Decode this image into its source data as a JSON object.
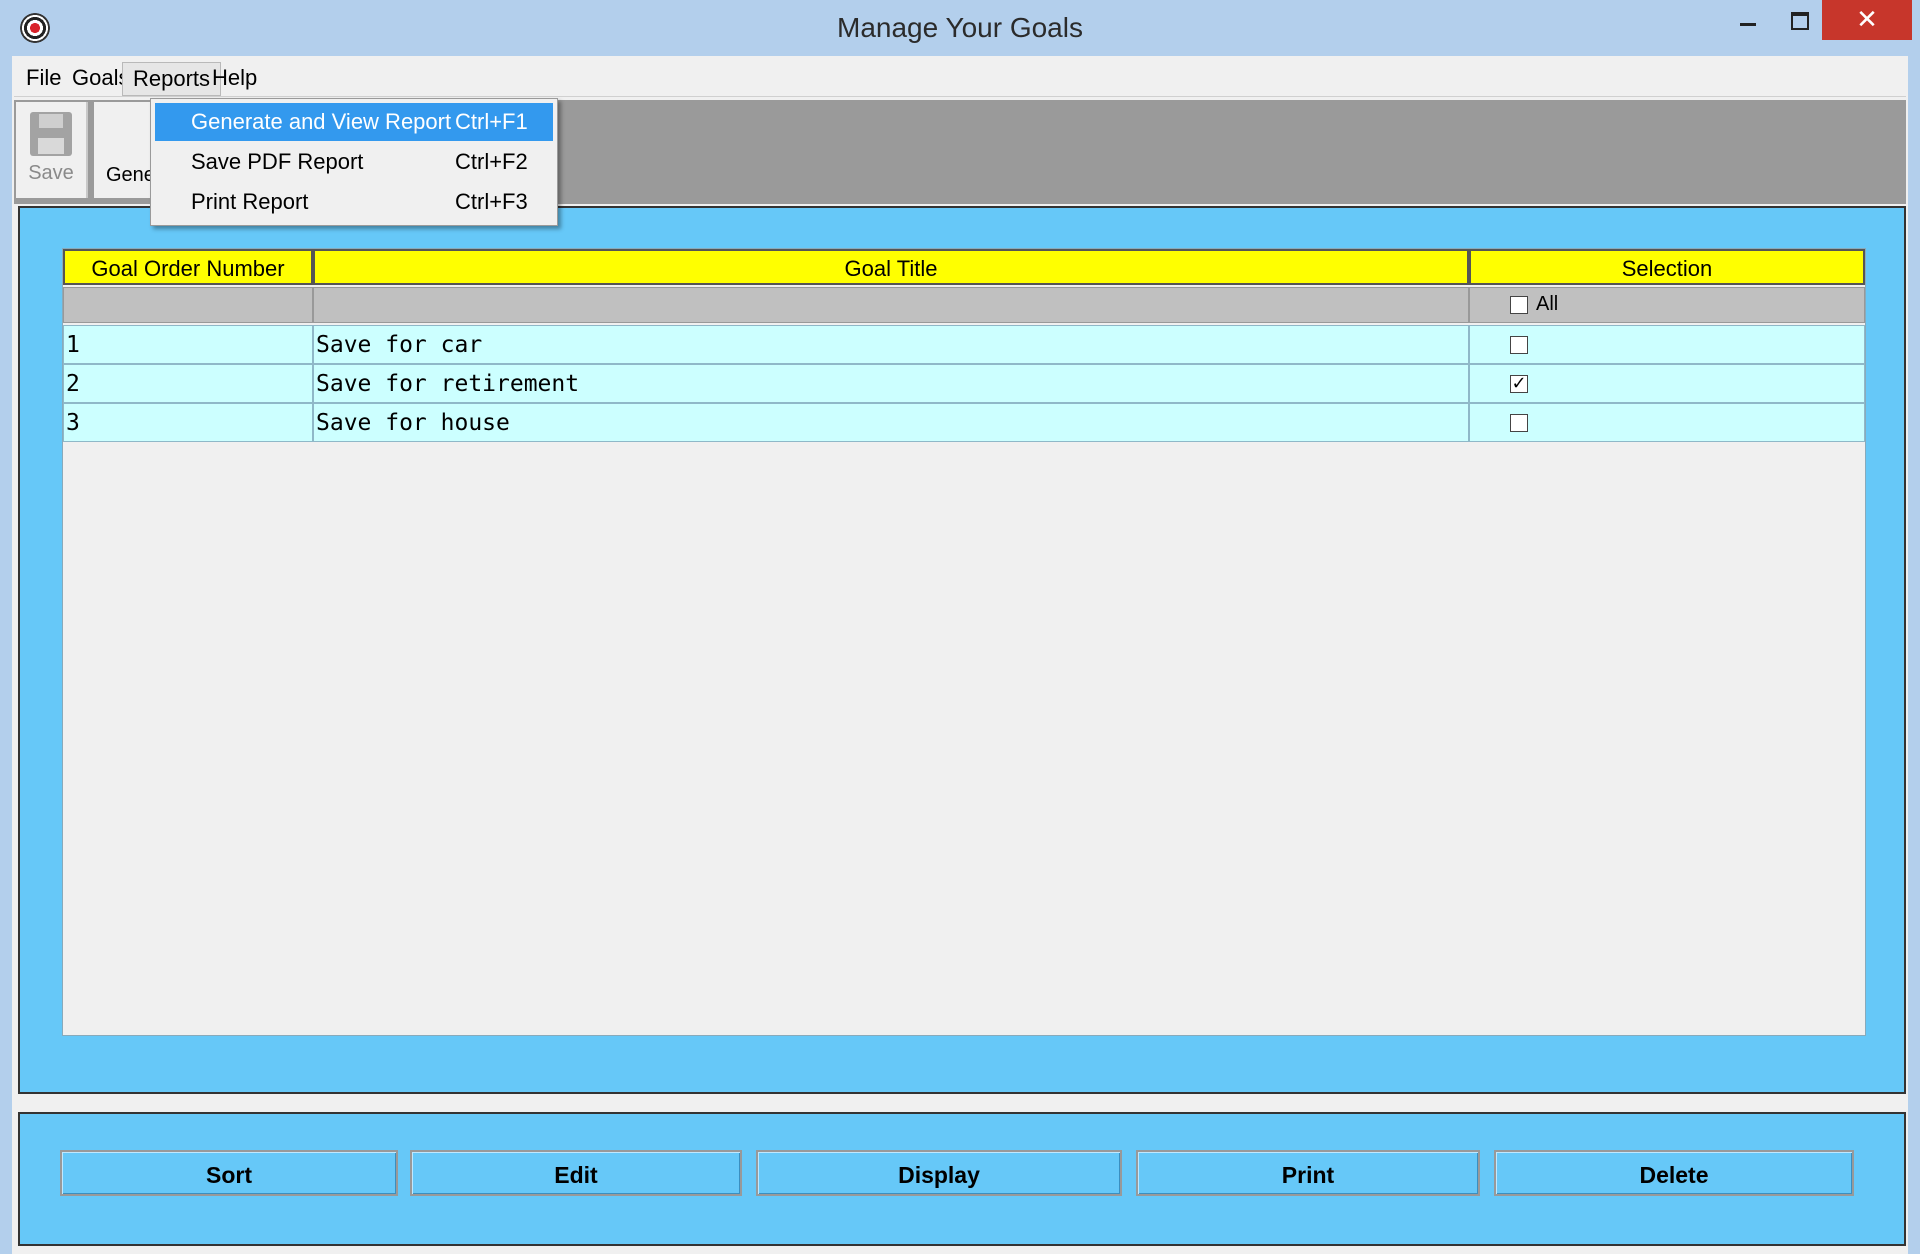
{
  "window": {
    "title": "Manage Your Goals",
    "close_glyph": "✕"
  },
  "menubar": {
    "items": [
      "File",
      "Goals",
      "Reports",
      "Help"
    ],
    "open_menu": "Reports"
  },
  "toolbar": {
    "save_label": "Save",
    "generate_label": "Gene"
  },
  "reports_menu": {
    "items": [
      {
        "label": "Generate and View Report",
        "shortcut": "Ctrl+F1",
        "highlighted": true
      },
      {
        "label": "Save PDF Report",
        "shortcut": "Ctrl+F2",
        "highlighted": false
      },
      {
        "label": "Print Report",
        "shortcut": "Ctrl+F3",
        "highlighted": false
      }
    ]
  },
  "table": {
    "columns": [
      "Goal Order Number",
      "Goal Title",
      "Selection"
    ],
    "select_all_label": "All",
    "select_all_checked": false,
    "rows": [
      {
        "order": "1",
        "title": "Save for car",
        "checked": false
      },
      {
        "order": "2",
        "title": "Save for retirement",
        "checked": true
      },
      {
        "order": "3",
        "title": "Save for house",
        "checked": false
      }
    ]
  },
  "actions": {
    "sort": "Sort",
    "edit": "Edit",
    "display": "Display",
    "print": "Print",
    "delete": "Delete"
  },
  "colors": {
    "panel": "#66c8f8",
    "header": "#ffff00",
    "row": "#ccffff",
    "menu_highlight": "#3399ee",
    "close_button": "#c7362b"
  }
}
